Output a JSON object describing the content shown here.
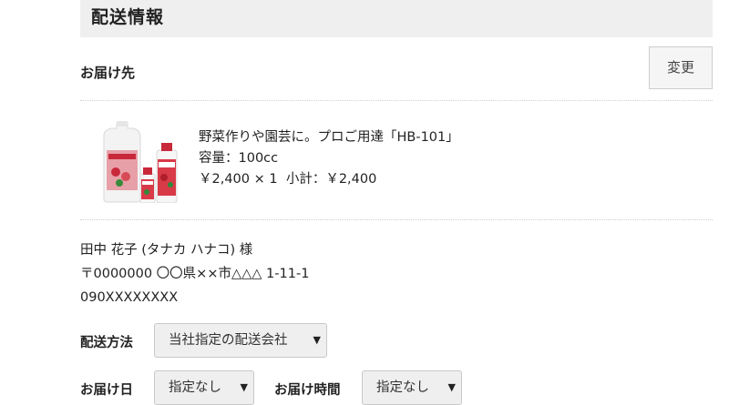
{
  "header": {
    "title": "配送情報"
  },
  "destination": {
    "label": "お届け先",
    "change_button": "変更"
  },
  "product": {
    "name": "野菜作りや園芸に。プロご用達「HB-101」",
    "capacity": "容量：100cc",
    "price_line": "￥2,400 × 1  小計：￥2,400"
  },
  "address": {
    "name": "田中 花子 (タナカ ハナコ) 様",
    "postal": "〒0000000 〇〇県××市△△△ 1-11-1",
    "phone": "090XXXXXXXX"
  },
  "shipping": {
    "method_label": "配送方法",
    "method_value": "当社指定の配送会社",
    "date_label": "お届け日",
    "date_value": "指定なし",
    "time_label": "お届け時間",
    "time_value": "指定なし"
  }
}
